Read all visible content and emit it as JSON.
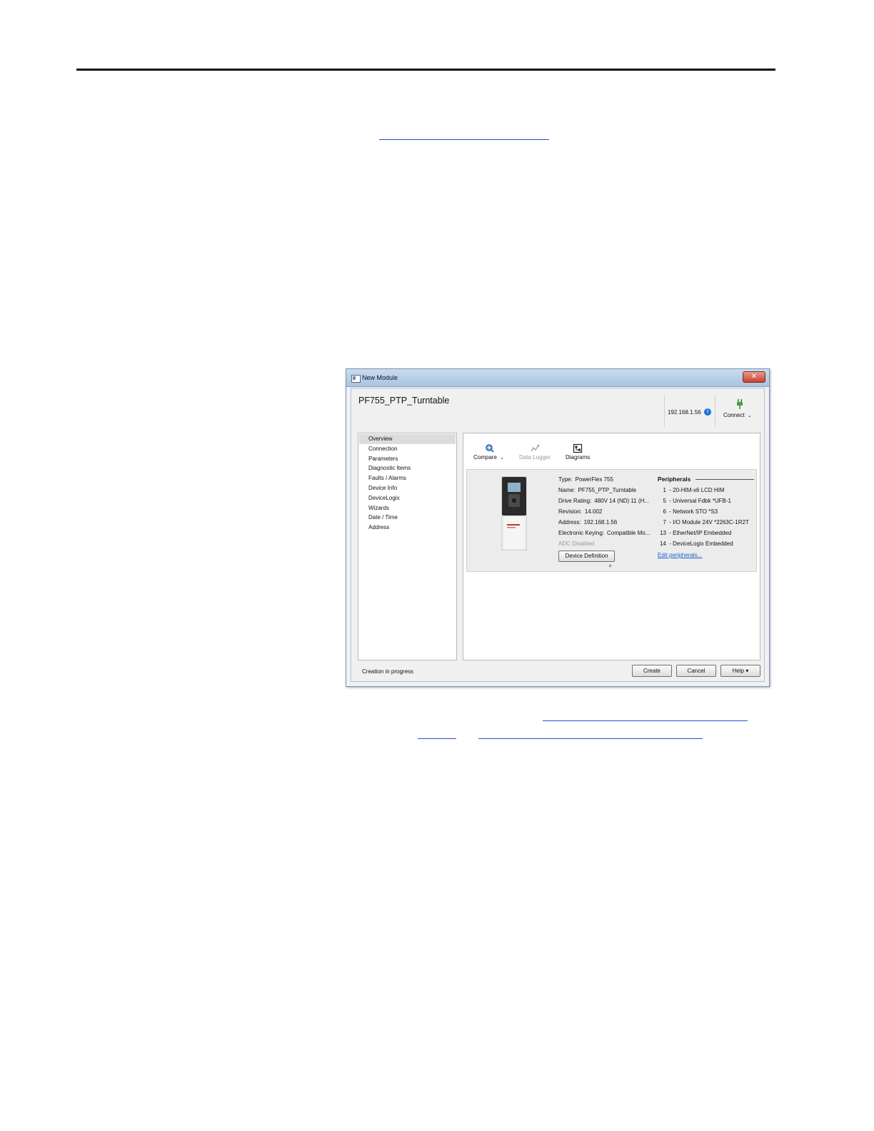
{
  "window": {
    "title": "New Module",
    "close_glyph": "✕",
    "module_name": "PF755_PTP_Turntable"
  },
  "header": {
    "ip_address": "192.168.1.56",
    "info_glyph": "i",
    "connect_label": "Connect",
    "connect_chevron": "⌄"
  },
  "nav": {
    "items": [
      {
        "label": "Overview",
        "selected": true
      },
      {
        "label": "Connection"
      },
      {
        "label": "Parameters"
      },
      {
        "label": "Diagnostic Items"
      },
      {
        "label": "Faults / Alarms"
      },
      {
        "label": "Device Info"
      },
      {
        "label": "DeviceLogix"
      },
      {
        "label": "Wizards"
      },
      {
        "label": "Date / Time"
      },
      {
        "label": "Address"
      }
    ]
  },
  "toolbar": {
    "compare_label": "Compare",
    "compare_chevron": "⌄",
    "data_logger_label": "Data Logger",
    "diagrams_label": "Diagrams"
  },
  "overview": {
    "type_key": "Type:",
    "type_val": "PowerFlex 755",
    "name_key": "Name:",
    "name_val": "PF755_PTP_Turntable",
    "rating_key": "Drive Rating:",
    "rating_val": "480V 14 (ND) 11 (H...",
    "revision_key": "Revision:",
    "revision_val": "14.002",
    "address_key": "Address:",
    "address_val": "192.168.1.56",
    "keying_key": "Electronic Keying:",
    "keying_val": "Compatible Mo...",
    "adc_text": "ADC Disabled",
    "device_definition_label": "Device Definition",
    "collapse_glyph": "«"
  },
  "peripherals": {
    "title": "Peripherals",
    "items": [
      {
        "port": "1",
        "name": "20-HIM-x6 LCD HIM"
      },
      {
        "port": "5",
        "name": "Universal Fdbk *UFB-1"
      },
      {
        "port": "6",
        "name": "Network STO *S3"
      },
      {
        "port": "7",
        "name": "I/O Module 24V *2263C-1R2T"
      },
      {
        "port": "13",
        "name": "EtherNet/IP Embedded"
      },
      {
        "port": "14",
        "name": "DeviceLogix Embedded"
      }
    ],
    "separator": "-",
    "edit_link": "Edit peripherals..."
  },
  "footer": {
    "status": "Creation in progress",
    "create_label": "Create",
    "cancel_label": "Cancel",
    "help_label": "Help ▾"
  }
}
